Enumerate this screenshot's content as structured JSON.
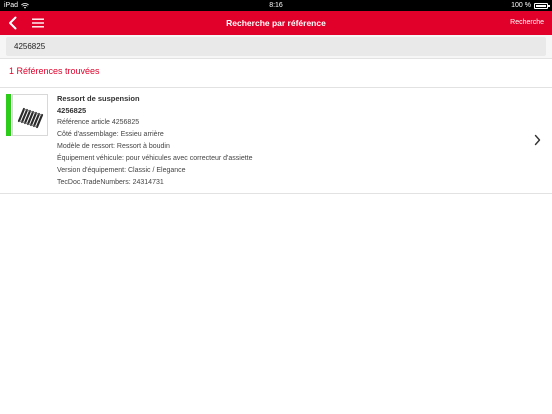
{
  "status_bar": {
    "device": "iPad",
    "time": "8:16",
    "battery": "100 %"
  },
  "nav": {
    "title": "Recherche par référence",
    "action_label": "Recherche"
  },
  "search": {
    "value": "4256825"
  },
  "results": {
    "count_label": "1 Références trouvées",
    "items": [
      {
        "name": "Ressort de suspension",
        "reference": "4256825",
        "details": [
          "Référence article 4256825",
          "Côté d'assemblage: Essieu arrière",
          "Modèle de ressort: Ressort à boudin",
          "Équipement véhicule: pour véhicules avec correcteur d'assiette",
          "Version d'équipement: Classic / Elegance",
          "TecDoc.TradeNumbers: 24314731"
        ],
        "stock_color": "#2ecc1a"
      }
    ]
  },
  "colors": {
    "brand": "#e0002a",
    "accent_text": "#e0002a"
  },
  "icons": {
    "back": "chevron-left-icon",
    "menu": "hamburger-menu-icon",
    "wifi": "wifi-icon",
    "battery": "battery-icon",
    "row_chevron": "chevron-right-icon",
    "thumbnail": "coil-spring-image"
  }
}
